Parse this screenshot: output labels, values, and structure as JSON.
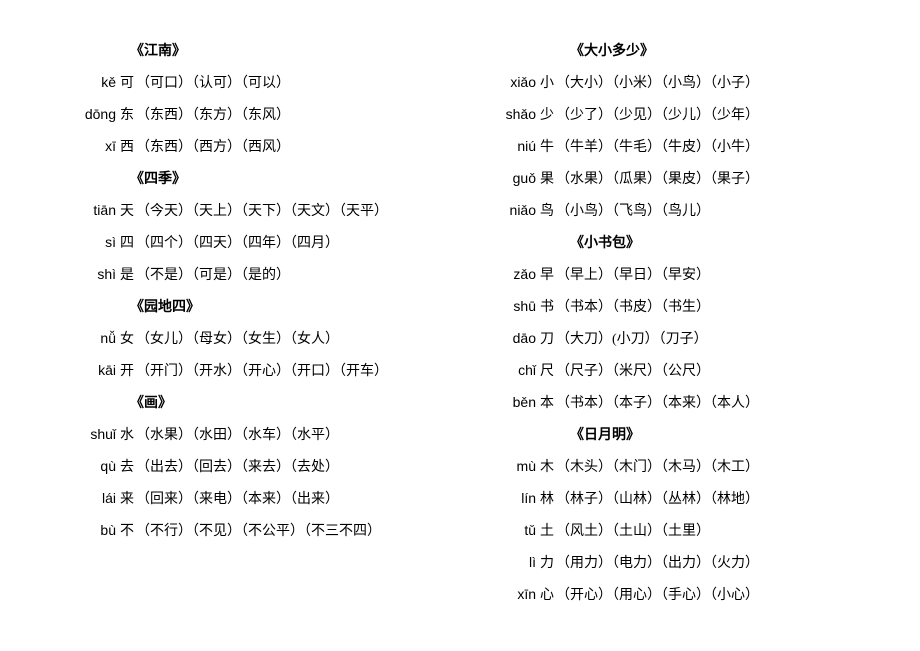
{
  "left": {
    "sections": [
      {
        "title": "《江南》",
        "entries": [
          {
            "pinyin": "kě",
            "hanzi": "可",
            "compounds": "（可口）（认可）（可以）"
          },
          {
            "pinyin": "dōng",
            "hanzi": "东",
            "compounds": "（东西）（东方）（东风）"
          },
          {
            "pinyin": "xī",
            "hanzi": "西",
            "compounds": "（东西）（西方）（西风）"
          }
        ]
      },
      {
        "title": "《四季》",
        "entries": [
          {
            "pinyin": "tiān",
            "hanzi": "天",
            "compounds": "（今天）（天上）（天下）（天文）（天平）"
          },
          {
            "pinyin": "sì",
            "hanzi": "四",
            "compounds": "（四个）（四天）（四年）（四月）"
          },
          {
            "pinyin": "shì",
            "hanzi": "是",
            "compounds": "（不是）（可是）（是的）"
          }
        ]
      },
      {
        "title": "《园地四》",
        "entries": [
          {
            "pinyin": "nǚ",
            "hanzi": "女",
            "compounds": "（女儿）（母女）（女生）（女人）"
          },
          {
            "pinyin": "kāi",
            "hanzi": "开",
            "compounds": "（开门）（开水）（开心）（开口）（开车）"
          }
        ]
      },
      {
        "title": "《画》",
        "entries": [
          {
            "pinyin": "shuǐ",
            "hanzi": "水",
            "compounds": "（水果）（水田）（水车）（水平）"
          },
          {
            "pinyin": "qù",
            "hanzi": "去",
            "compounds": "（出去）（回去）（来去）（去处）"
          },
          {
            "pinyin": "lái",
            "hanzi": "来",
            "compounds": "（回来）（来电）（本来）（出来）"
          },
          {
            "pinyin": "bù",
            "hanzi": "不",
            "compounds": "（不行）（不见）（不公平）（不三不四）"
          }
        ]
      }
    ]
  },
  "right": {
    "sections": [
      {
        "title": "《大小多少》",
        "entries": [
          {
            "pinyin": "xiǎo",
            "hanzi": "小",
            "compounds": "（大小）（小米）（小鸟）（小子）"
          },
          {
            "pinyin": "shǎo",
            "hanzi": "少",
            "compounds": "（少了）（少见）（少儿）（少年）"
          },
          {
            "pinyin": "niú",
            "hanzi": "牛",
            "compounds": "（牛羊）（牛毛）（牛皮）（小牛）"
          },
          {
            "pinyin": "guǒ",
            "hanzi": "果",
            "compounds": "（水果）（瓜果）（果皮）（果子）"
          },
          {
            "pinyin": "niǎo",
            "hanzi": "鸟",
            "compounds": "（小鸟）（飞鸟）（鸟儿）"
          }
        ]
      },
      {
        "title": "《小书包》",
        "entries": [
          {
            "pinyin": "zǎo",
            "hanzi": "早",
            "compounds": "（早上）（早日）（早安）"
          },
          {
            "pinyin": "shū",
            "hanzi": "书",
            "compounds": "（书本）（书皮）（书生）"
          },
          {
            "pinyin": "dāo",
            "hanzi": "刀",
            "compounds": "（大刀）(小刀）（刀子）"
          },
          {
            "pinyin": "chǐ",
            "hanzi": "尺",
            "compounds": "（尺子）（米尺）（公尺）"
          },
          {
            "pinyin": "běn",
            "hanzi": "本",
            "compounds": "（书本）（本子）（本来）（本人）"
          }
        ]
      },
      {
        "title": "《日月明》",
        "entries": [
          {
            "pinyin": "mù",
            "hanzi": "木",
            "compounds": "（木头）（木门）（木马）（木工）"
          },
          {
            "pinyin": "lín",
            "hanzi": "林",
            "compounds": "（林子）（山林）（丛林）（林地）"
          },
          {
            "pinyin": "tǔ",
            "hanzi": "土",
            "compounds": "（风土）（土山）（土里）"
          },
          {
            "pinyin": "lì",
            "hanzi": "力",
            "compounds": "（用力）（电力）（出力）（火力）"
          },
          {
            "pinyin": "xīn",
            "hanzi": "心",
            "compounds": "（开心）（用心）（手心）（小心）"
          }
        ]
      }
    ]
  }
}
